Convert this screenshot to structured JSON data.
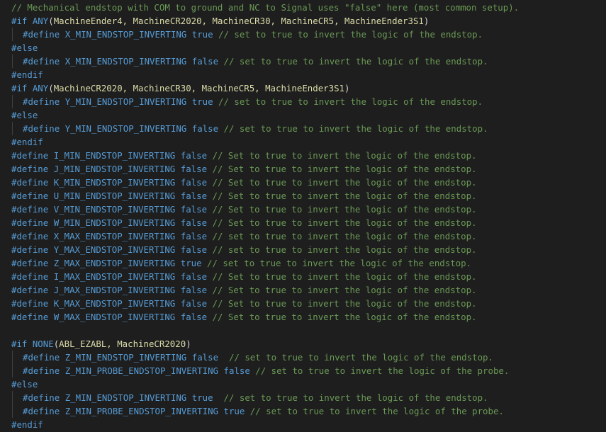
{
  "editor": {
    "lines": [
      {
        "indent": false,
        "tokens": [
          {
            "t": "comment",
            "v": "// Mechanical endstop with COM to ground and NC to Signal uses \"false\" here (most common setup)."
          }
        ]
      },
      {
        "indent": false,
        "tokens": [
          {
            "t": "directive",
            "v": "#if "
          },
          {
            "t": "macro",
            "v": "ANY"
          },
          {
            "t": "plain",
            "v": "("
          },
          {
            "t": "func",
            "v": "MachineEnder4, MachineCR2020, MachineCR30, MachineCR5, MachineEnder3S1"
          },
          {
            "t": "plain",
            "v": ")"
          }
        ]
      },
      {
        "indent": true,
        "tokens": [
          {
            "t": "directive",
            "v": "#define "
          },
          {
            "t": "macro",
            "v": "X_MIN_ENDSTOP_INVERTING "
          },
          {
            "t": "value",
            "v": "true "
          },
          {
            "t": "comment",
            "v": "// set to true to invert the logic of the endstop."
          }
        ]
      },
      {
        "indent": false,
        "tokens": [
          {
            "t": "directive",
            "v": "#else"
          }
        ]
      },
      {
        "indent": true,
        "tokens": [
          {
            "t": "directive",
            "v": "#define "
          },
          {
            "t": "macro",
            "v": "X_MIN_ENDSTOP_INVERTING "
          },
          {
            "t": "value",
            "v": "false "
          },
          {
            "t": "comment",
            "v": "// set to true to invert the logic of the endstop."
          }
        ]
      },
      {
        "indent": false,
        "tokens": [
          {
            "t": "directive",
            "v": "#endif"
          }
        ]
      },
      {
        "indent": false,
        "tokens": [
          {
            "t": "directive",
            "v": "#if "
          },
          {
            "t": "macro",
            "v": "ANY"
          },
          {
            "t": "plain",
            "v": "("
          },
          {
            "t": "func",
            "v": "MachineCR2020, MachineCR30, MachineCR5, MachineEnder3S1"
          },
          {
            "t": "plain",
            "v": ")"
          }
        ]
      },
      {
        "indent": true,
        "tokens": [
          {
            "t": "directive",
            "v": "#define "
          },
          {
            "t": "macro",
            "v": "Y_MIN_ENDSTOP_INVERTING "
          },
          {
            "t": "value",
            "v": "true "
          },
          {
            "t": "comment",
            "v": "// set to true to invert the logic of the endstop."
          }
        ]
      },
      {
        "indent": false,
        "tokens": [
          {
            "t": "directive",
            "v": "#else"
          }
        ]
      },
      {
        "indent": true,
        "tokens": [
          {
            "t": "directive",
            "v": "#define "
          },
          {
            "t": "macro",
            "v": "Y_MIN_ENDSTOP_INVERTING "
          },
          {
            "t": "value",
            "v": "false "
          },
          {
            "t": "comment",
            "v": "// set to true to invert the logic of the endstop."
          }
        ]
      },
      {
        "indent": false,
        "tokens": [
          {
            "t": "directive",
            "v": "#endif"
          }
        ]
      },
      {
        "indent": false,
        "tokens": [
          {
            "t": "directive",
            "v": "#define "
          },
          {
            "t": "macro",
            "v": "I_MIN_ENDSTOP_INVERTING "
          },
          {
            "t": "value",
            "v": "false "
          },
          {
            "t": "comment",
            "v": "// Set to true to invert the logic of the endstop."
          }
        ]
      },
      {
        "indent": false,
        "tokens": [
          {
            "t": "directive",
            "v": "#define "
          },
          {
            "t": "macro",
            "v": "J_MIN_ENDSTOP_INVERTING "
          },
          {
            "t": "value",
            "v": "false "
          },
          {
            "t": "comment",
            "v": "// Set to true to invert the logic of the endstop."
          }
        ]
      },
      {
        "indent": false,
        "tokens": [
          {
            "t": "directive",
            "v": "#define "
          },
          {
            "t": "macro",
            "v": "K_MIN_ENDSTOP_INVERTING "
          },
          {
            "t": "value",
            "v": "false "
          },
          {
            "t": "comment",
            "v": "// Set to true to invert the logic of the endstop."
          }
        ]
      },
      {
        "indent": false,
        "tokens": [
          {
            "t": "directive",
            "v": "#define "
          },
          {
            "t": "macro",
            "v": "U_MIN_ENDSTOP_INVERTING "
          },
          {
            "t": "value",
            "v": "false "
          },
          {
            "t": "comment",
            "v": "// Set to true to invert the logic of the endstop."
          }
        ]
      },
      {
        "indent": false,
        "tokens": [
          {
            "t": "directive",
            "v": "#define "
          },
          {
            "t": "macro",
            "v": "V_MIN_ENDSTOP_INVERTING "
          },
          {
            "t": "value",
            "v": "false "
          },
          {
            "t": "comment",
            "v": "// Set to true to invert the logic of the endstop."
          }
        ]
      },
      {
        "indent": false,
        "tokens": [
          {
            "t": "directive",
            "v": "#define "
          },
          {
            "t": "macro",
            "v": "W_MIN_ENDSTOP_INVERTING "
          },
          {
            "t": "value",
            "v": "false "
          },
          {
            "t": "comment",
            "v": "// Set to true to invert the logic of the endstop."
          }
        ]
      },
      {
        "indent": false,
        "tokens": [
          {
            "t": "directive",
            "v": "#define "
          },
          {
            "t": "macro",
            "v": "X_MAX_ENDSTOP_INVERTING "
          },
          {
            "t": "value",
            "v": "false "
          },
          {
            "t": "comment",
            "v": "// set to true to invert the logic of the endstop."
          }
        ]
      },
      {
        "indent": false,
        "tokens": [
          {
            "t": "directive",
            "v": "#define "
          },
          {
            "t": "macro",
            "v": "Y_MAX_ENDSTOP_INVERTING "
          },
          {
            "t": "value",
            "v": "false "
          },
          {
            "t": "comment",
            "v": "// set to true to invert the logic of the endstop."
          }
        ]
      },
      {
        "indent": false,
        "tokens": [
          {
            "t": "directive",
            "v": "#define "
          },
          {
            "t": "macro",
            "v": "Z_MAX_ENDSTOP_INVERTING "
          },
          {
            "t": "value",
            "v": "true "
          },
          {
            "t": "comment",
            "v": "// set to true to invert the logic of the endstop."
          }
        ]
      },
      {
        "indent": false,
        "tokens": [
          {
            "t": "directive",
            "v": "#define "
          },
          {
            "t": "macro",
            "v": "I_MAX_ENDSTOP_INVERTING "
          },
          {
            "t": "value",
            "v": "false "
          },
          {
            "t": "comment",
            "v": "// Set to true to invert the logic of the endstop."
          }
        ]
      },
      {
        "indent": false,
        "tokens": [
          {
            "t": "directive",
            "v": "#define "
          },
          {
            "t": "macro",
            "v": "J_MAX_ENDSTOP_INVERTING "
          },
          {
            "t": "value",
            "v": "false "
          },
          {
            "t": "comment",
            "v": "// Set to true to invert the logic of the endstop."
          }
        ]
      },
      {
        "indent": false,
        "tokens": [
          {
            "t": "directive",
            "v": "#define "
          },
          {
            "t": "macro",
            "v": "K_MAX_ENDSTOP_INVERTING "
          },
          {
            "t": "value",
            "v": "false "
          },
          {
            "t": "comment",
            "v": "// Set to true to invert the logic of the endstop."
          }
        ]
      },
      {
        "indent": false,
        "tokens": [
          {
            "t": "directive",
            "v": "#define "
          },
          {
            "t": "macro",
            "v": "W_MAX_ENDSTOP_INVERTING "
          },
          {
            "t": "value",
            "v": "false "
          },
          {
            "t": "comment",
            "v": "// Set to true to invert the logic of the endstop."
          }
        ]
      },
      {
        "indent": false,
        "tokens": []
      },
      {
        "indent": false,
        "tokens": [
          {
            "t": "directive",
            "v": "#if "
          },
          {
            "t": "macro",
            "v": "NONE"
          },
          {
            "t": "plain",
            "v": "("
          },
          {
            "t": "func",
            "v": "ABL_EZABL, MachineCR2020"
          },
          {
            "t": "plain",
            "v": ")"
          }
        ]
      },
      {
        "indent": true,
        "tokens": [
          {
            "t": "directive",
            "v": "#define "
          },
          {
            "t": "macro",
            "v": "Z_MIN_ENDSTOP_INVERTING "
          },
          {
            "t": "value",
            "v": "false  "
          },
          {
            "t": "comment",
            "v": "// set to true to invert the logic of the endstop."
          }
        ]
      },
      {
        "indent": true,
        "tokens": [
          {
            "t": "directive",
            "v": "#define "
          },
          {
            "t": "macro",
            "v": "Z_MIN_PROBE_ENDSTOP_INVERTING "
          },
          {
            "t": "value",
            "v": "false "
          },
          {
            "t": "comment",
            "v": "// set to true to invert the logic of the probe."
          }
        ]
      },
      {
        "indent": false,
        "tokens": [
          {
            "t": "directive",
            "v": "#else"
          }
        ]
      },
      {
        "indent": true,
        "tokens": [
          {
            "t": "directive",
            "v": "#define "
          },
          {
            "t": "macro",
            "v": "Z_MIN_ENDSTOP_INVERTING "
          },
          {
            "t": "value",
            "v": "true  "
          },
          {
            "t": "comment",
            "v": "// set to true to invert the logic of the endstop."
          }
        ]
      },
      {
        "indent": true,
        "tokens": [
          {
            "t": "directive",
            "v": "#define "
          },
          {
            "t": "macro",
            "v": "Z_MIN_PROBE_ENDSTOP_INVERTING "
          },
          {
            "t": "value",
            "v": "true "
          },
          {
            "t": "comment",
            "v": "// set to true to invert the logic of the probe."
          }
        ]
      },
      {
        "indent": false,
        "tokens": [
          {
            "t": "directive",
            "v": "#endif"
          }
        ]
      }
    ]
  },
  "colors": {
    "background": "#1e1e1e",
    "comment": "#6a9955",
    "keyword": "#569cd6",
    "function_args": "#dcdcaa",
    "plain": "#d4d4d4"
  }
}
